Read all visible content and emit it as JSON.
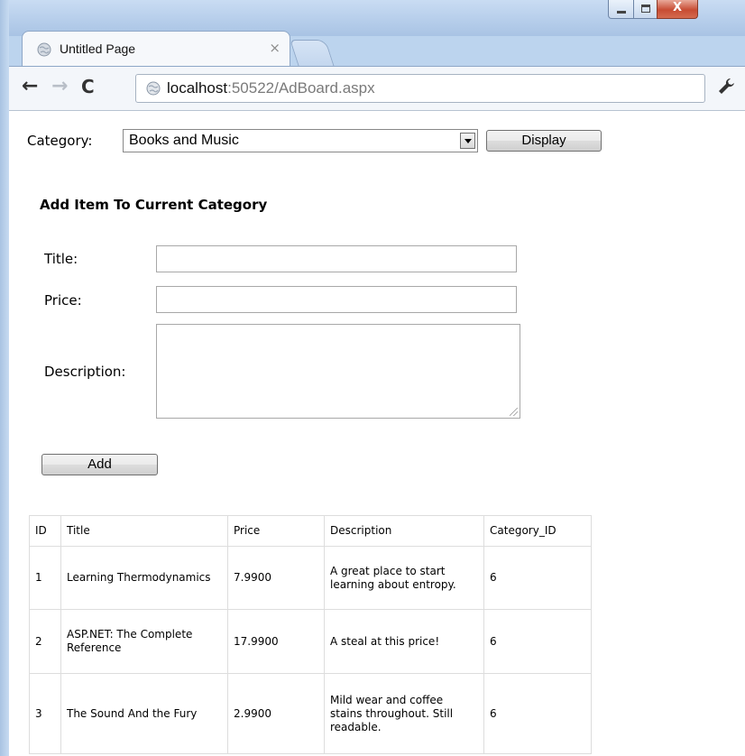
{
  "browser": {
    "tab_title": "Untitled Page",
    "tab_close": "×",
    "url_host": "localhost",
    "url_rest": ":50522/AdBoard.aspx",
    "icons": [
      "globe-icon",
      "back-arrow-icon",
      "forward-arrow-icon",
      "reload-icon",
      "wrench-icon"
    ],
    "window_buttons": {
      "minimize": "",
      "maximize": "",
      "close": "X"
    }
  },
  "page": {
    "category_label": "Category:",
    "category_selected": "Books and Music",
    "display_button": "Display",
    "add_heading": "Add Item To Current Category",
    "title_label": "Title:",
    "price_label": "Price:",
    "description_label": "Description:",
    "title_value": "",
    "price_value": "",
    "description_value": "",
    "add_button": "Add"
  },
  "grid": {
    "headers": [
      "ID",
      "Title",
      "Price",
      "Description",
      "Category_ID"
    ],
    "rows": [
      [
        "1",
        "Learning Thermodynamics",
        "7.9900",
        "A great place to start learning about entropy.",
        "6"
      ],
      [
        "2",
        "ASP.NET: The Complete Reference",
        "17.9900",
        "A steal at this price!",
        "6"
      ],
      [
        "3",
        "The Sound And the Fury",
        "2.9900",
        "Mild wear and coffee stains throughout. Still readable.",
        "6"
      ]
    ]
  }
}
